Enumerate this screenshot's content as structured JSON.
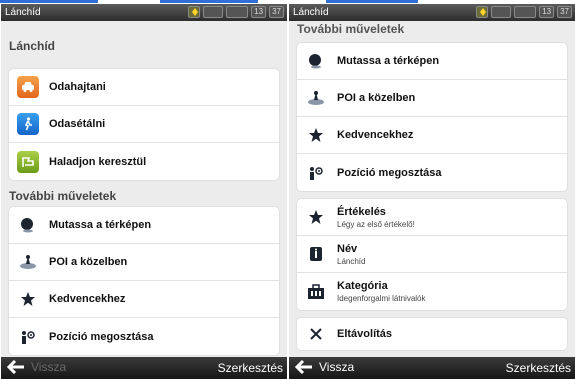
{
  "left_screen": {
    "status": {
      "title": "Lánchíd",
      "battery": "",
      "signal": "",
      "hour": "13",
      "minute": "37"
    },
    "header": "Lánchíd",
    "nav_items": [
      {
        "label": "Odahajtani",
        "icon": "car-icon",
        "color": "#e8731f"
      },
      {
        "label": "Odasétálni",
        "icon": "walking-person-icon",
        "color": "#1e7fdc"
      },
      {
        "label": "Haladjon keresztül",
        "icon": "route-flag-icon",
        "color": "#86b22a"
      }
    ],
    "section_title": "További műveletek",
    "actions": [
      {
        "label": "Mutassa a térképen",
        "icon": "map-pin-icon"
      },
      {
        "label": "POI a közelben",
        "icon": "poi-nearby-icon"
      },
      {
        "label": "Kedvencekhez",
        "icon": "star-icon"
      },
      {
        "label": "Pozíció megosztása",
        "icon": "share-position-icon"
      }
    ],
    "bottom": {
      "back_label": "Vissza",
      "edit_label": "Szerkesztés"
    }
  },
  "right_screen": {
    "status": {
      "title": "Lánchíd",
      "hour": "13",
      "minute": "37"
    },
    "section_title": "További műveletek",
    "actions": [
      {
        "label": "Mutassa a térképen",
        "icon": "map-pin-icon"
      },
      {
        "label": "POI a közelben",
        "icon": "poi-nearby-icon"
      },
      {
        "label": "Kedvencekhez",
        "icon": "star-icon"
      },
      {
        "label": "Pozíció megosztása",
        "icon": "share-position-icon"
      }
    ],
    "details": [
      {
        "label": "Értékelés",
        "sub": "Légy az első értékelő!",
        "icon": "star-icon"
      },
      {
        "label": "Név",
        "sub": "Lánchíd",
        "icon": "name-tag-icon"
      },
      {
        "label": "Kategória",
        "sub": "Idegenforgalmi látnivalók",
        "icon": "category-icon"
      }
    ],
    "remove_label": "Eltávolítás",
    "bottom": {
      "back_label": "Vissza",
      "edit_label": "Szerkesztés"
    }
  }
}
